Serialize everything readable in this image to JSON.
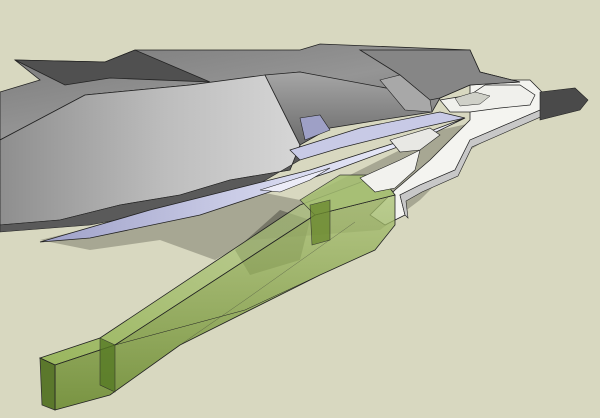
{
  "viewport": {
    "background": "#d8d8c0"
  },
  "colors": {
    "background": "#d8d8c0",
    "roof_dark": "#5c5c5c",
    "roof_mid": "#8a8a8a",
    "roof_light": "#b8b8b8",
    "shadow": "#7e7e72",
    "slab_white": "#f4f4f0",
    "slab_side": "#cfcfcf",
    "blade_light": "#e4e6f4",
    "blade_mid": "#b6b8d8",
    "blade_dark": "#8c8eb4",
    "glass_green": "#9ab860",
    "glass_dark": "#5c7a28",
    "edge": "#222222"
  }
}
